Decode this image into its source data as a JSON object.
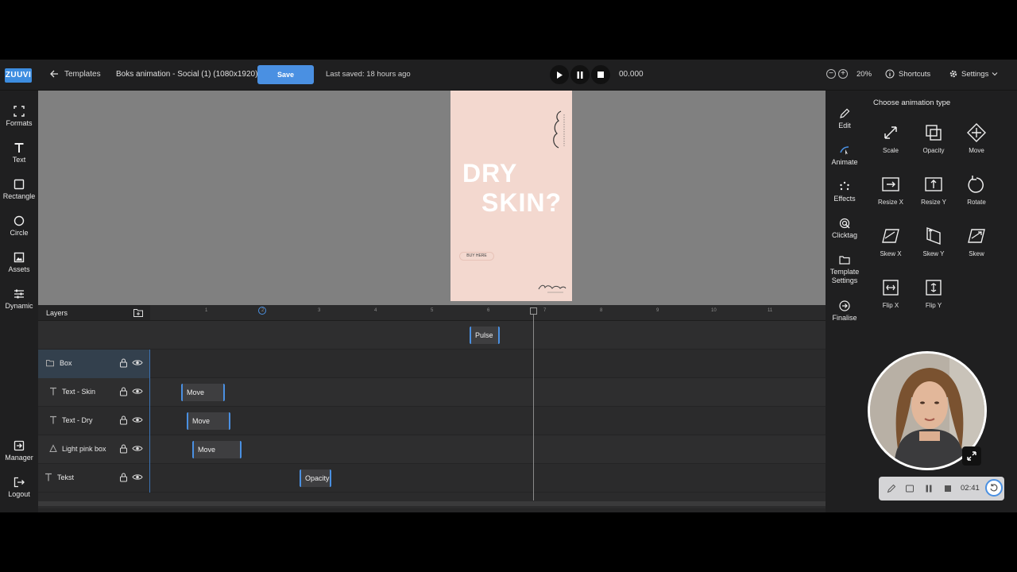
{
  "topbar": {
    "logo": "ZUUVI",
    "back_label": "Templates",
    "doc_title": "Boks animation - Social (1) (1080x1920)",
    "save_label": "Save",
    "last_saved": "Last saved: 18 hours ago",
    "timecode": "00.000",
    "zoom": "20%",
    "shortcuts": "Shortcuts",
    "settings": "Settings"
  },
  "leftbar": {
    "formats": "Formats",
    "text": "Text",
    "rectangle": "Rectangle",
    "circle": "Circle",
    "assets": "Assets",
    "dynamic": "Dynamic",
    "manager": "Manager",
    "logout": "Logout"
  },
  "artboard": {
    "headline_line1": "DRY",
    "headline_line2": "SKIN?",
    "button_label": "BUY HERE",
    "bg_color": "#f3d8cf"
  },
  "timeline": {
    "layers_title": "Layers",
    "ticks": [
      "1",
      "2",
      "3",
      "4",
      "5",
      "6",
      "7",
      "8",
      "9",
      "10",
      "11"
    ],
    "layers": [
      {
        "name": "",
        "clip": "Pulse"
      },
      {
        "name": "Box",
        "clip": ""
      },
      {
        "name": "Text - Skin",
        "clip": "Move"
      },
      {
        "name": "Text - Dry",
        "clip": "Move"
      },
      {
        "name": "Light pink box",
        "clip": "Move"
      },
      {
        "name": "Tekst",
        "clip": "Opacity"
      }
    ]
  },
  "righttabs": {
    "edit": "Edit",
    "animate": "Animate",
    "effects": "Effects",
    "clicktag": "Clicktag",
    "template_settings_1": "Template",
    "template_settings_2": "Settings",
    "finalise": "Finalise"
  },
  "animpanel": {
    "title": "Choose animation type",
    "types": [
      "Scale",
      "Opacity",
      "Move",
      "Resize X",
      "Resize Y",
      "Rotate",
      "Skew X",
      "Skew Y",
      "Skew",
      "Flip X",
      "Flip Y"
    ]
  },
  "recorder": {
    "time": "02:41"
  },
  "colors": {
    "accent": "#4a90e2",
    "panel": "#1f1f20",
    "canvas": "#808080"
  }
}
